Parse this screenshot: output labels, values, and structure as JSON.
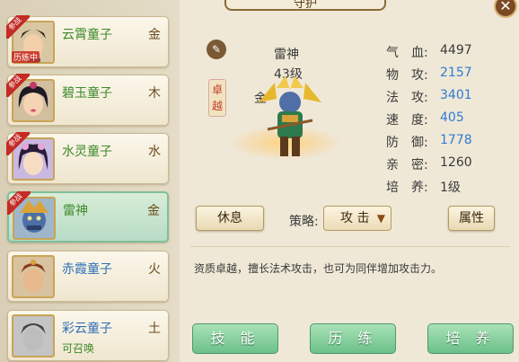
{
  "title": "守护",
  "hero_list": [
    {
      "name": "云霄童子",
      "element": "金",
      "badge": "参战",
      "sub_tag": "历练中",
      "name_color": "green"
    },
    {
      "name": "碧玉童子",
      "element": "木",
      "badge": "参战",
      "name_color": "green"
    },
    {
      "name": "水灵童子",
      "element": "水",
      "badge": "参战",
      "name_color": "green"
    },
    {
      "name": "雷神",
      "element": "金",
      "badge": "参战",
      "name_color": "green",
      "selected": true
    },
    {
      "name": "赤霞童子",
      "element": "火",
      "name_color": "blue"
    },
    {
      "name": "彩云童子",
      "element": "土",
      "sub_text": "可召唤",
      "name_color": "blue"
    }
  ],
  "character": {
    "name": "雷神",
    "level": "43级",
    "element": "金",
    "quality": "卓越"
  },
  "stats": [
    {
      "label": "气　血:",
      "value": "4497",
      "color": "normal"
    },
    {
      "label": "物　攻:",
      "value": "2157",
      "color": "blue"
    },
    {
      "label": "法　攻:",
      "value": "3401",
      "color": "blue"
    },
    {
      "label": "速　度:",
      "value": "405",
      "color": "blue"
    },
    {
      "label": "防　御:",
      "value": "1778",
      "color": "blue"
    },
    {
      "label": "亲　密:",
      "value": "1260",
      "color": "normal"
    },
    {
      "label": "培　养:",
      "value": "1级",
      "color": "normal"
    }
  ],
  "actions": {
    "rest": "休息",
    "strategy_label": "策略:",
    "strategy_value": "攻 击",
    "attributes": "属性"
  },
  "description": "资质卓越，擅长法术攻击，也可为同伴增加攻击力。",
  "bottom_buttons": {
    "skills": "技 能",
    "train": "历 练",
    "cultivate": "培 养"
  },
  "icons": {
    "close": "close-icon",
    "edit": "pencil-icon",
    "dropdown": "dropdown-arrow-icon"
  },
  "colors": {
    "green_text": "#3f8a2c",
    "blue_text": "#2e7bd6",
    "badge_red": "#c42b25",
    "selected_bg": "#b8dcc6",
    "bottom_button": "#6cc08a"
  }
}
